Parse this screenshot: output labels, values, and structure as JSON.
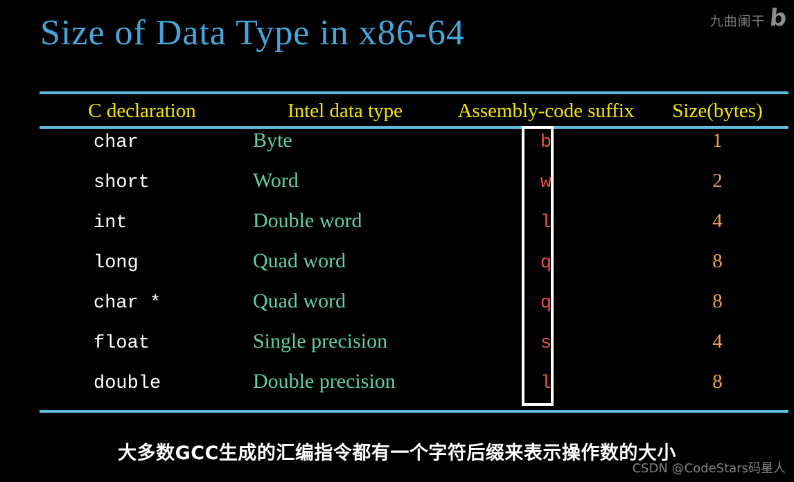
{
  "slide": {
    "title": "Size of Data Type in x86-64",
    "caption": "大多数GCC生成的汇编指令都有一个字符后缀来表示操作数的大小"
  },
  "watermarks": {
    "top_right_text": "九曲阑干",
    "top_right_logo": "b",
    "bottom_right": "CSDN @CodeStars码星人"
  },
  "table": {
    "headers": [
      "C declaration",
      "Intel data type",
      "Assembly-code suffix",
      "Size(bytes)"
    ],
    "rows": [
      {
        "declaration": "char",
        "intel": "Byte",
        "suffix": "b",
        "size": "1"
      },
      {
        "declaration": "short",
        "intel": "Word",
        "suffix": "w",
        "size": "2"
      },
      {
        "declaration": "int",
        "intel": "Double word",
        "suffix": "l",
        "size": "4"
      },
      {
        "declaration": "long",
        "intel": "Quad word",
        "suffix": "q",
        "size": "8"
      },
      {
        "declaration": "char *",
        "intel": "Quad word",
        "suffix": "q",
        "size": "8"
      },
      {
        "declaration": "float",
        "intel": "Single precision",
        "suffix": "s",
        "size": "4"
      },
      {
        "declaration": "double",
        "intel": "Double precision",
        "suffix": "l",
        "size": "8"
      }
    ]
  },
  "colors": {
    "background": "#000000",
    "title": "#45a6da",
    "rule": "#5cb9e0",
    "header_text": "#f2e600",
    "declaration_text": "#ffffff",
    "intel_text": "#5fceac",
    "suffix_text": "#e7523c",
    "size_text": "#e8a14e",
    "highlight_box": "#ffffff",
    "caption_text": "#ffffff"
  }
}
